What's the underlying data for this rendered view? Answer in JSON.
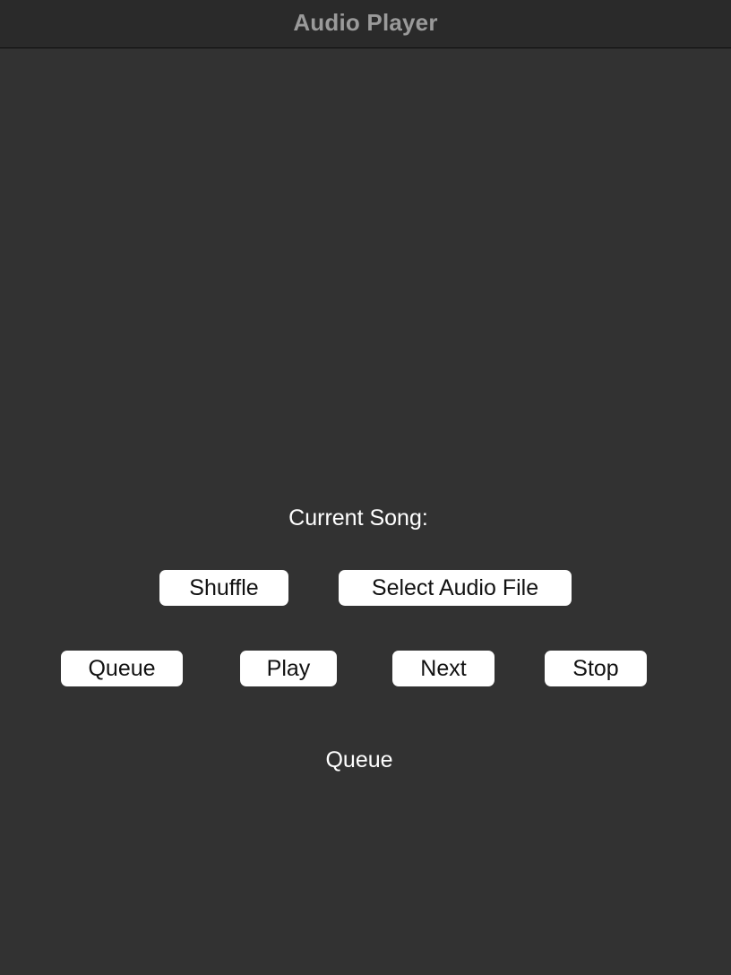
{
  "window": {
    "title": "Audio Player"
  },
  "player": {
    "current_song_label": "Current Song:",
    "queue_heading": "Queue"
  },
  "buttons": {
    "shuffle": "Shuffle",
    "select_audio_file": "Select Audio File",
    "queue": "Queue",
    "play": "Play",
    "next": "Next",
    "stop": "Stop"
  },
  "colors": {
    "background": "#323232",
    "titlebar": "#2a2a2a",
    "title_text": "#9a9a9a",
    "button_bg": "#ffffff",
    "label_text": "#ffffff"
  }
}
